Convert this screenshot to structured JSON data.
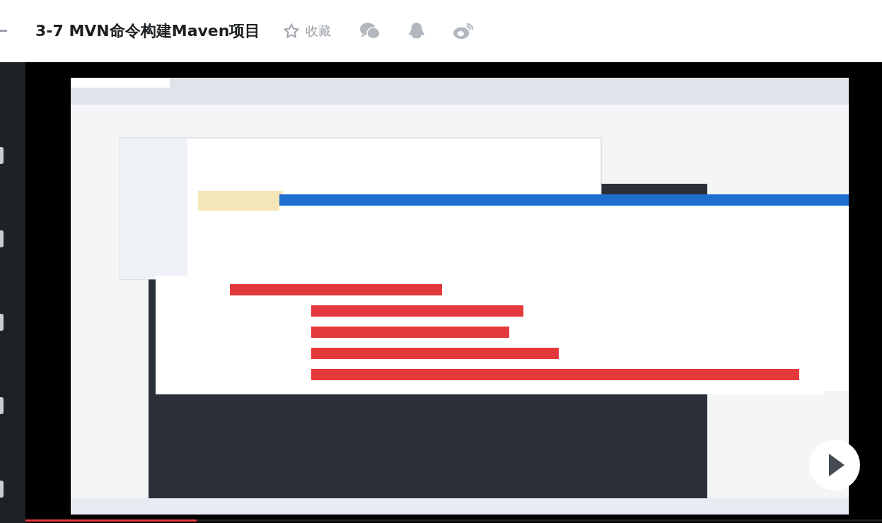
{
  "header": {
    "title": "3-7 MVN命令构建Maven项目",
    "favorite": {
      "label": "收藏",
      "selected": false
    }
  },
  "video": {
    "progress": {
      "level": 0.2
    }
  }
}
